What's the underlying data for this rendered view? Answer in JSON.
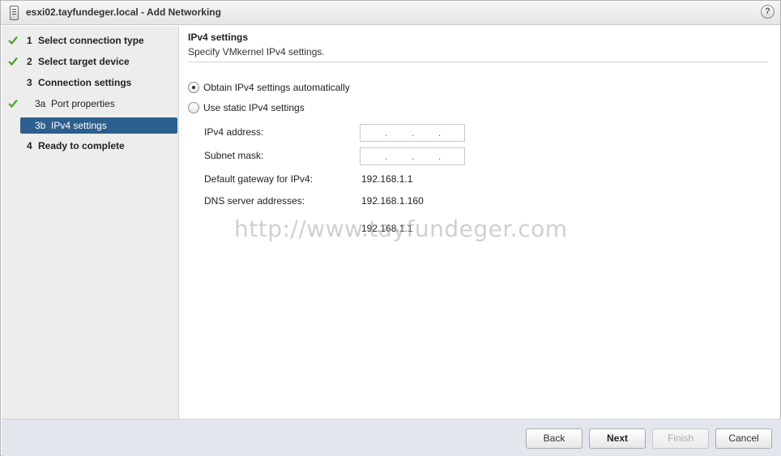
{
  "window": {
    "title": "esxi02.tayfundeger.local - Add Networking",
    "help_glyph": "?"
  },
  "steps": [
    {
      "num": "1",
      "label": "Select connection type",
      "completed": true,
      "sub": false,
      "active": false
    },
    {
      "num": "2",
      "label": "Select target device",
      "completed": true,
      "sub": false,
      "active": false
    },
    {
      "num": "3",
      "label": "Connection settings",
      "completed": false,
      "sub": false,
      "active": false
    },
    {
      "num": "3a",
      "label": "Port properties",
      "completed": true,
      "sub": true,
      "active": false
    },
    {
      "num": "3b",
      "label": "IPv4 settings",
      "completed": false,
      "sub": true,
      "active": true
    },
    {
      "num": "4",
      "label": "Ready to complete",
      "completed": false,
      "sub": false,
      "active": false
    }
  ],
  "main": {
    "title": "IPv4 settings",
    "subtitle": "Specify VMkernel IPv4 settings.",
    "option_auto": "Obtain IPv4 settings automatically",
    "option_static": "Use static IPv4 settings",
    "selected_option": "auto",
    "ipv4_address_label": "IPv4 address:",
    "subnet_mask_label": "Subnet mask:",
    "gateway_label": "Default gateway for IPv4:",
    "gateway_value": "192.168.1.1",
    "dns_label": "DNS server addresses:",
    "dns_value_1": "192.168.1.160",
    "dns_value_2": "192.168.1.1"
  },
  "watermark": "http://www.tayfundeger.com",
  "buttons": {
    "back": "Back",
    "next": "Next",
    "finish": "Finish",
    "cancel": "Cancel"
  },
  "colors": {
    "active_step_bg": "#2c5f8e",
    "check_green": "#4aa02c",
    "footer_bg": "#e3e6ec"
  },
  "icons": {
    "title": "server-icon",
    "completed_step": "check-icon",
    "help": "help-icon"
  }
}
